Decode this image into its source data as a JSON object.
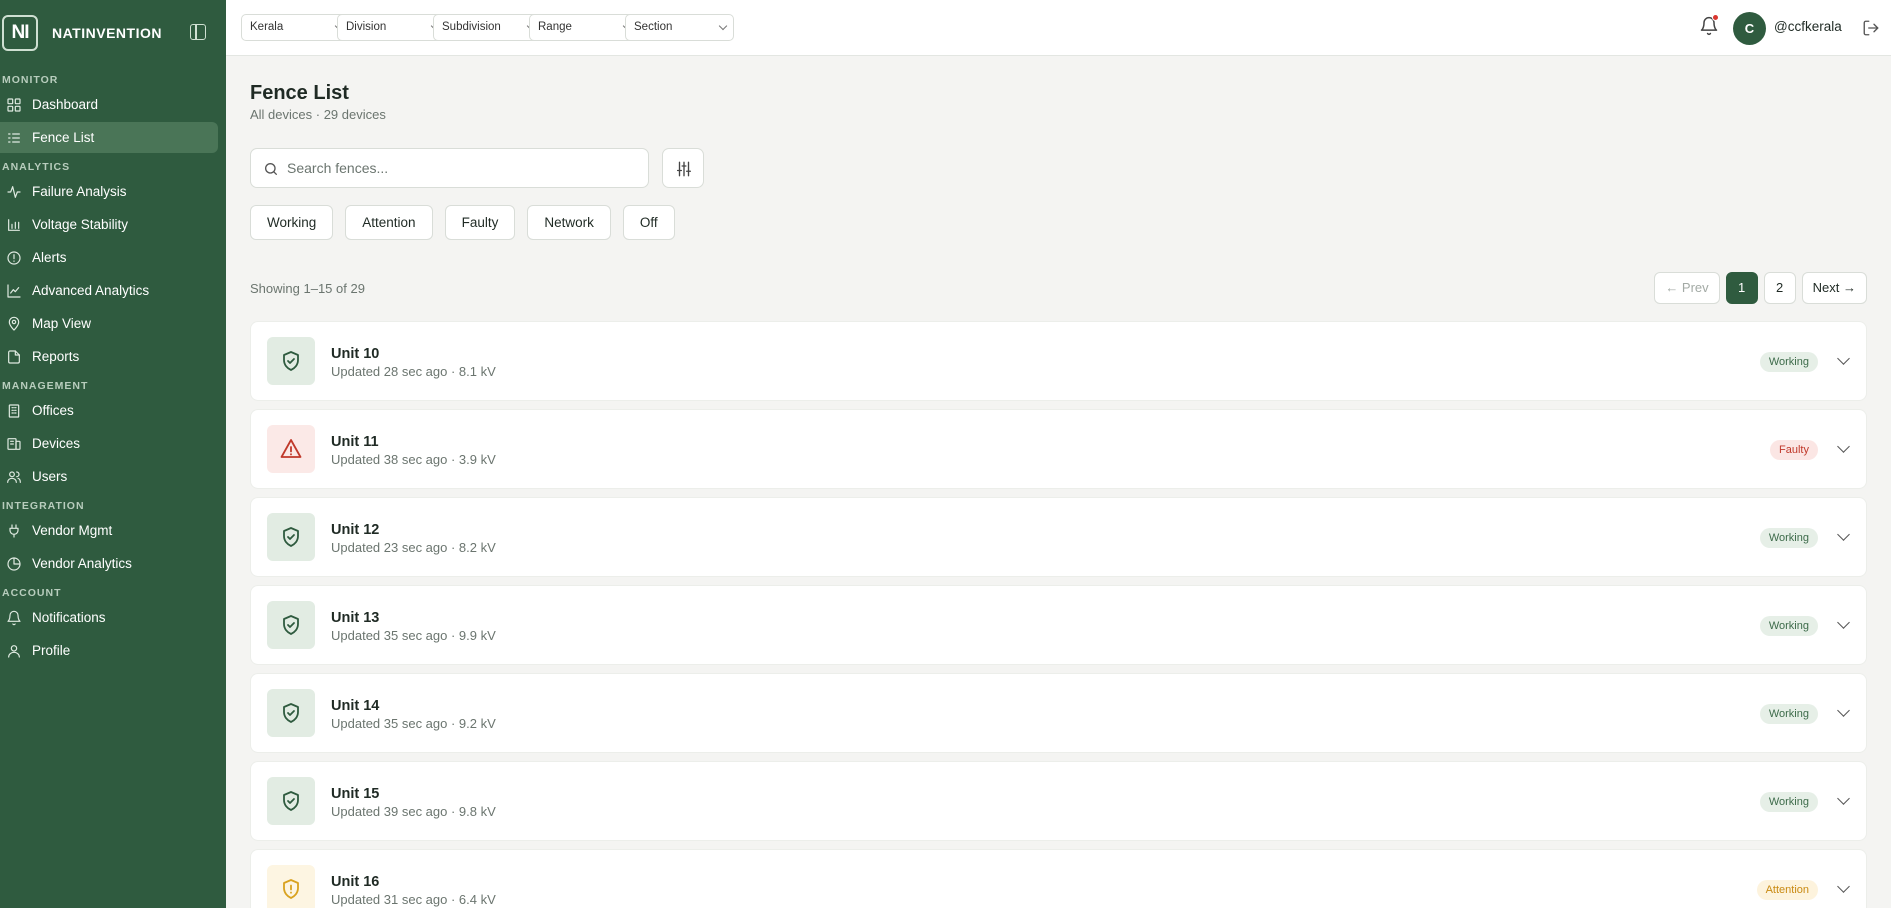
{
  "brand": {
    "logo": "NI",
    "name": "NATINVENTION"
  },
  "sidebar": {
    "sections": [
      {
        "label": "MONITOR",
        "items": [
          {
            "label": "Dashboard",
            "icon": "dashboard-icon",
            "active": false
          },
          {
            "label": "Fence List",
            "icon": "list-icon",
            "active": true
          }
        ]
      },
      {
        "label": "ANALYTICS",
        "items": [
          {
            "label": "Failure Analysis",
            "icon": "activity-icon",
            "active": false
          },
          {
            "label": "Voltage Stability",
            "icon": "bar-chart-icon",
            "active": false
          },
          {
            "label": "Alerts",
            "icon": "alert-circle-icon",
            "active": false
          },
          {
            "label": "Advanced Analytics",
            "icon": "trend-icon",
            "active": false
          },
          {
            "label": "Map View",
            "icon": "map-pin-icon",
            "active": false
          },
          {
            "label": "Reports",
            "icon": "file-icon",
            "active": false
          }
        ]
      },
      {
        "label": "MANAGEMENT",
        "items": [
          {
            "label": "Offices",
            "icon": "building-icon",
            "active": false
          },
          {
            "label": "Devices",
            "icon": "devices-icon",
            "active": false
          },
          {
            "label": "Users",
            "icon": "users-icon",
            "active": false
          }
        ]
      },
      {
        "label": "INTEGRATION",
        "items": [
          {
            "label": "Vendor Mgmt",
            "icon": "plug-icon",
            "active": false
          },
          {
            "label": "Vendor Analytics",
            "icon": "pie-icon",
            "active": false
          }
        ]
      },
      {
        "label": "ACCOUNT",
        "items": [
          {
            "label": "Notifications",
            "icon": "bell-icon",
            "active": false
          },
          {
            "label": "Profile",
            "icon": "user-icon",
            "active": false
          }
        ]
      }
    ]
  },
  "topbar": {
    "filters": [
      "Kerala",
      "Division",
      "Subdivision",
      "Range",
      "Section"
    ],
    "user": {
      "initial": "C",
      "handle": "@ccfkerala"
    }
  },
  "page": {
    "title": "Fence List",
    "subtitle": "All devices · 29 devices",
    "search_placeholder": "Search fences...",
    "status_filters": [
      "Working",
      "Attention",
      "Faulty",
      "Network",
      "Off"
    ],
    "showing": "Showing 1–15 of 29",
    "pagination": {
      "prev": "← Prev",
      "pages": [
        "1",
        "2"
      ],
      "current": "1",
      "next": "Next →"
    }
  },
  "status_colors": {
    "Working": {
      "bg": "#e6efe7",
      "fg": "#3d6b4a",
      "icon_bg": "#e2ece3",
      "icon": "#2f5b3f"
    },
    "Faulty": {
      "bg": "#fbe6e4",
      "fg": "#c0392b",
      "icon_bg": "#fbe9e7",
      "icon": "#c0392b"
    },
    "Attention": {
      "bg": "#fdf3dd",
      "fg": "#c98a12",
      "icon_bg": "#fdf5e2",
      "icon": "#d9a21f"
    }
  },
  "fences": [
    {
      "name": "Unit 10",
      "meta": "Updated 28 sec ago · 8.1 kV",
      "status": "Working"
    },
    {
      "name": "Unit 11",
      "meta": "Updated 38 sec ago · 3.9 kV",
      "status": "Faulty"
    },
    {
      "name": "Unit 12",
      "meta": "Updated 23 sec ago · 8.2 kV",
      "status": "Working"
    },
    {
      "name": "Unit 13",
      "meta": "Updated 35 sec ago · 9.9 kV",
      "status": "Working"
    },
    {
      "name": "Unit 14",
      "meta": "Updated 35 sec ago · 9.2 kV",
      "status": "Working"
    },
    {
      "name": "Unit 15",
      "meta": "Updated 39 sec ago · 9.8 kV",
      "status": "Working"
    },
    {
      "name": "Unit 16",
      "meta": "Updated 31 sec ago · 6.4 kV",
      "status": "Attention"
    }
  ]
}
